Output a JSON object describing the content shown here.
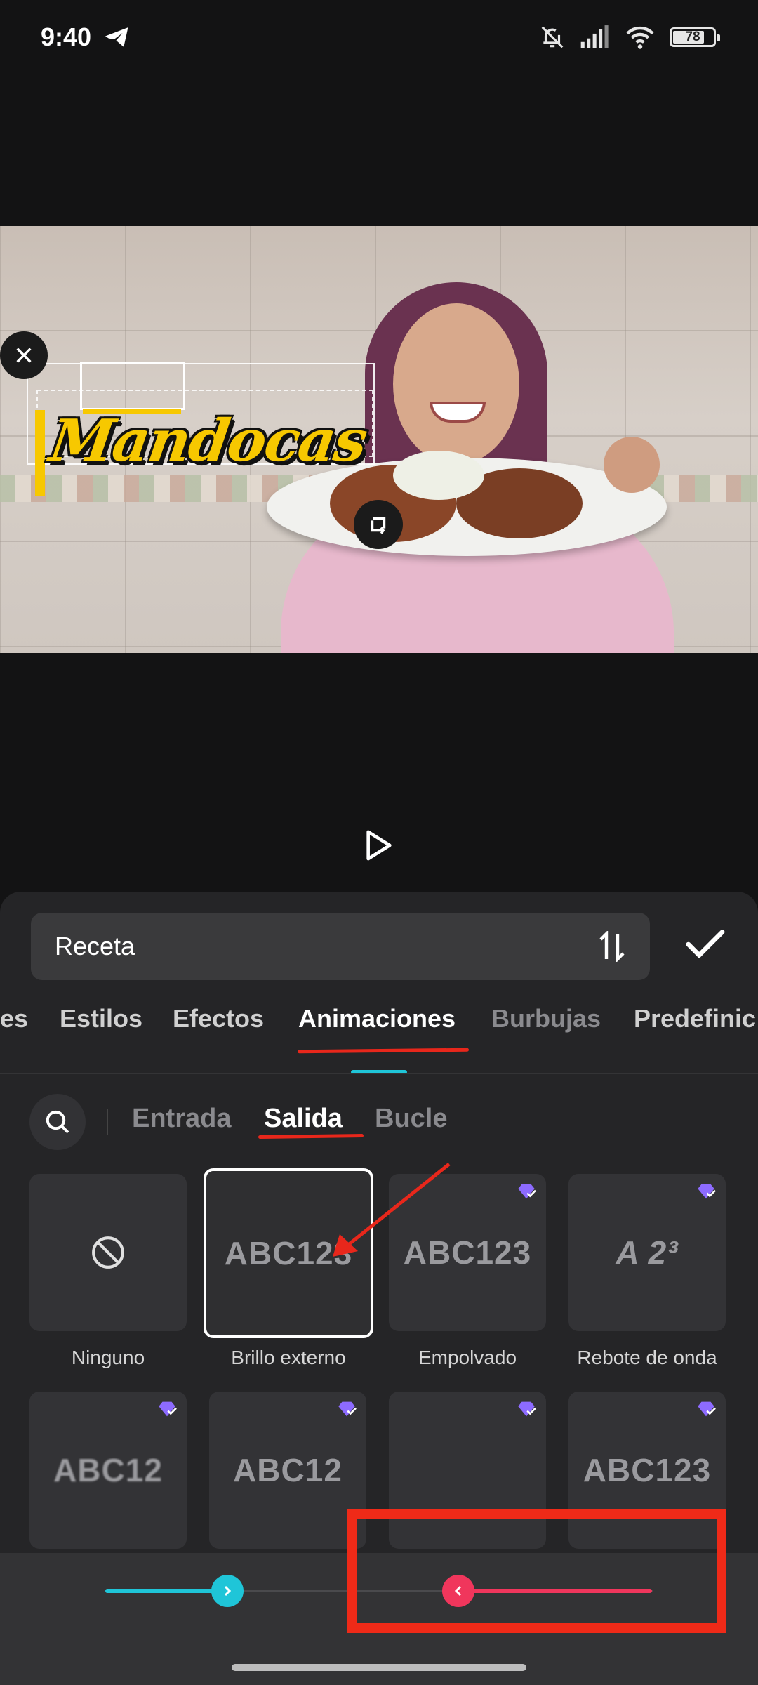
{
  "status_bar": {
    "time": "9:40",
    "battery": "78",
    "icons": [
      "telegram-icon",
      "bell-off-icon",
      "signal-icon",
      "wifi-icon",
      "battery-icon"
    ]
  },
  "preview": {
    "sticker_text": "Mandocas"
  },
  "editor": {
    "text_value": "Receta",
    "tabs": [
      "es",
      "Estilos",
      "Efectos",
      "Animaciones",
      "Burbujas",
      "Predefinic"
    ],
    "active_tab": "Animaciones",
    "subtabs": [
      "Entrada",
      "Salida",
      "Bucle"
    ],
    "active_subtab": "Salida",
    "animations_row1": [
      {
        "label": "Ninguno",
        "preview": "",
        "premium": false
      },
      {
        "label": "Brillo externo",
        "preview": "ABC123",
        "premium": false,
        "selected": true
      },
      {
        "label": "Empolvado",
        "preview": "ABC123",
        "premium": true
      },
      {
        "label": "Rebote de onda",
        "preview": "A   2³",
        "premium": true
      }
    ],
    "animations_row2": [
      {
        "preview": "ABC12",
        "premium": true
      },
      {
        "preview": "ABC12",
        "premium": true
      },
      {
        "preview": "",
        "premium": true
      },
      {
        "preview": "ABC123",
        "premium": true
      }
    ]
  },
  "colors": {
    "accent_in": "#1fc5d8",
    "accent_out": "#f0365c",
    "annotation": "#e8271b"
  }
}
